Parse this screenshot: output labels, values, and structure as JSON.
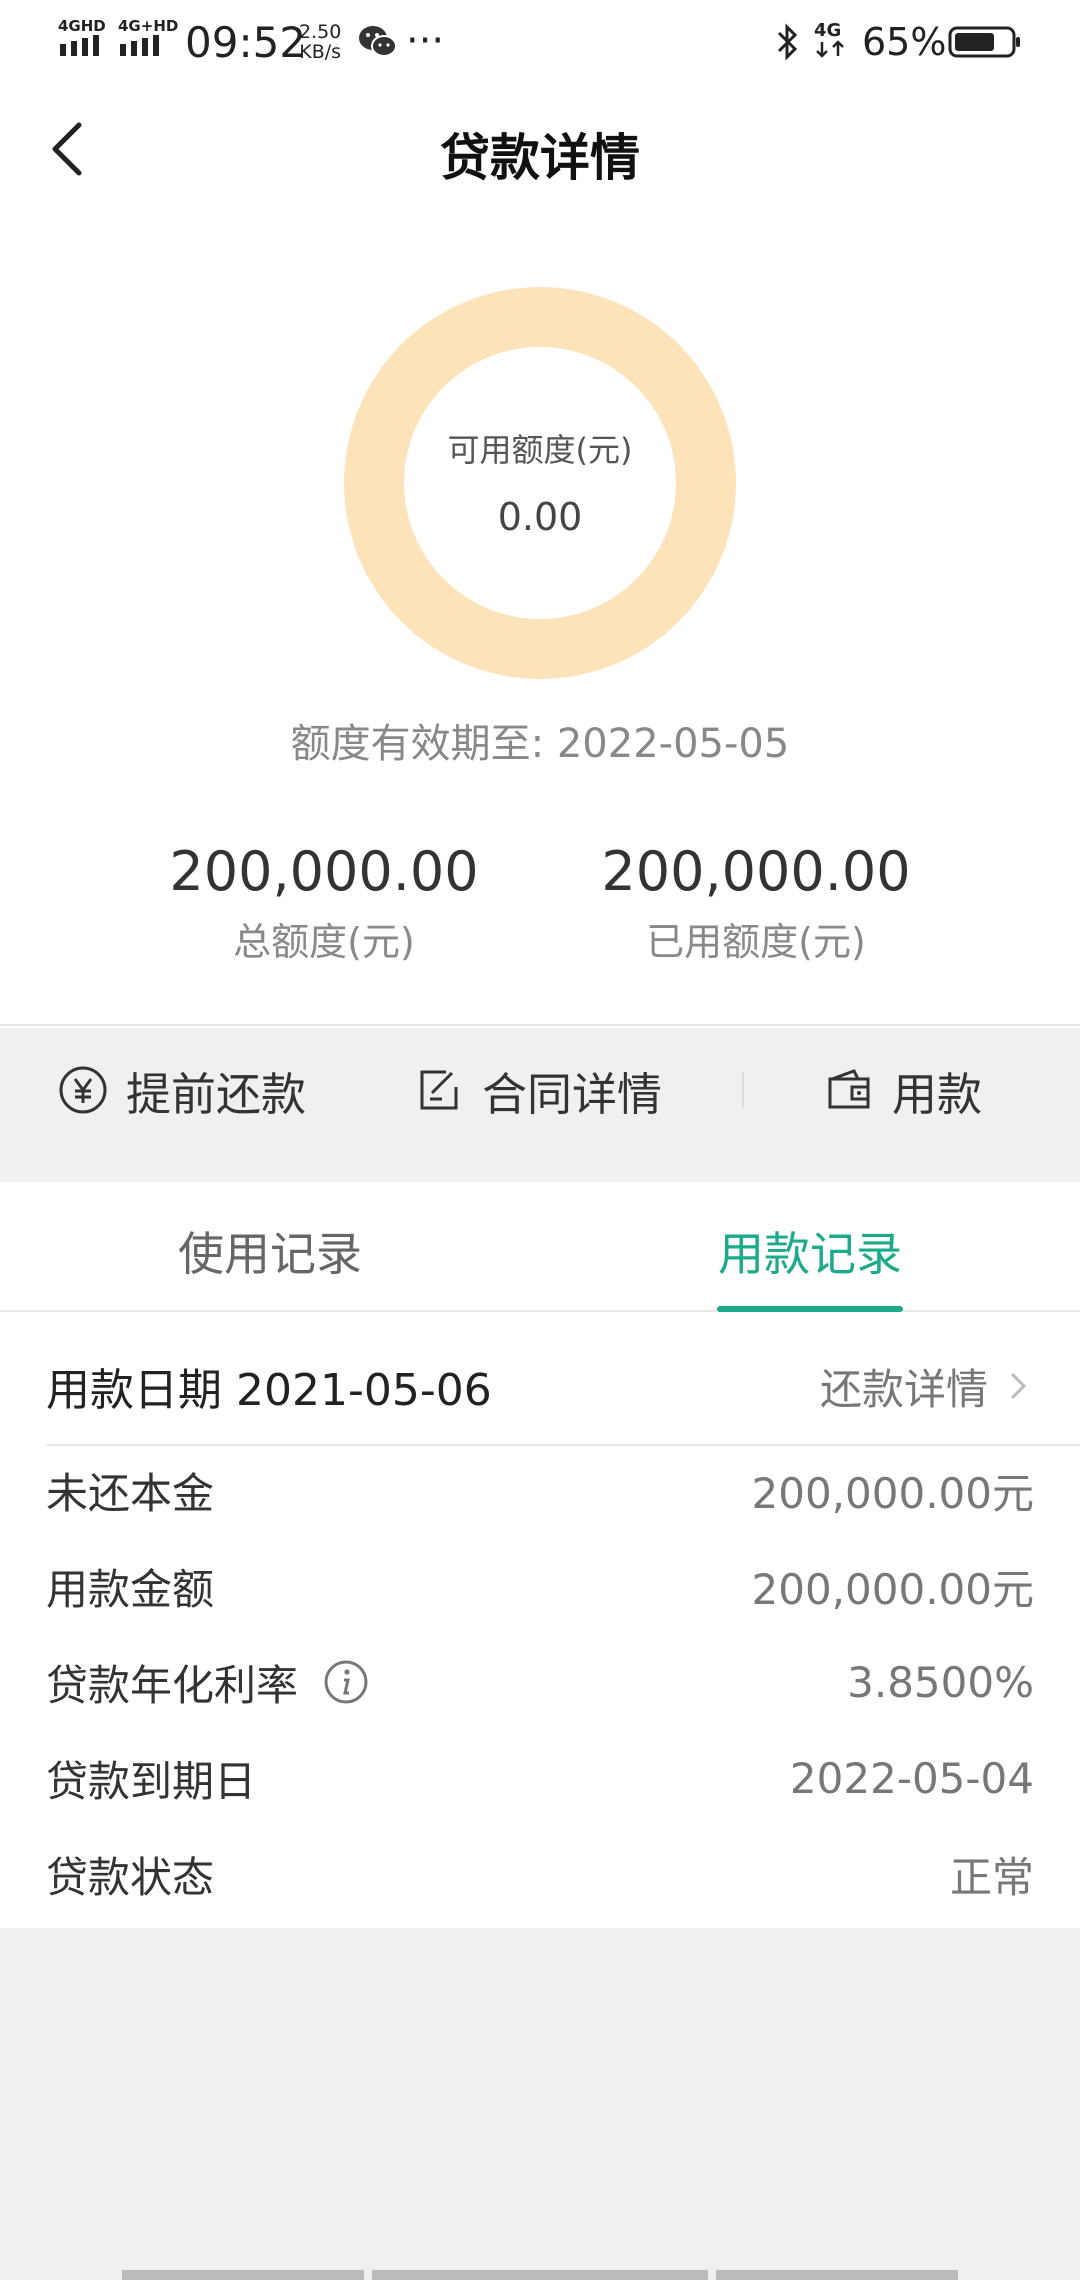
{
  "status_bar": {
    "network1": "4GHD",
    "network2": "4G+HD",
    "time": "09:52",
    "speed_value": "2.50",
    "speed_unit": "KB/s",
    "more": "···",
    "network3": "4G",
    "battery": "65%"
  },
  "header": {
    "title": "贷款详情"
  },
  "credit": {
    "available_label": "可用额度(元)",
    "available_value": "0.00",
    "expiry": "额度有效期至: 2022-05-05",
    "total_value": "200,000.00",
    "total_label": "总额度(元)",
    "used_value": "200,000.00",
    "used_label": "已用额度(元)",
    "ring_color": "#fde3b9"
  },
  "actions": [
    {
      "label": "提前还款",
      "icon": "yen-circle-icon"
    },
    {
      "label": "合同详情",
      "icon": "contract-edit-icon"
    },
    {
      "label": "用款",
      "icon": "wallet-icon"
    }
  ],
  "tabs": [
    {
      "label": "使用记录",
      "active": false
    },
    {
      "label": "用款记录",
      "active": true
    }
  ],
  "accent_color": "#1cab8a",
  "record": {
    "date_label": "用款日期 2021-05-06",
    "detail_link": "还款详情",
    "rows": [
      {
        "key": "未还本金",
        "value": "200,000.00元"
      },
      {
        "key": "用款金额",
        "value": "200,000.00元"
      },
      {
        "key": "贷款年化利率",
        "value": "3.8500%"
      },
      {
        "key": "贷款到期日",
        "value": "2022-05-04"
      },
      {
        "key": "贷款状态",
        "value": "正常"
      }
    ]
  }
}
